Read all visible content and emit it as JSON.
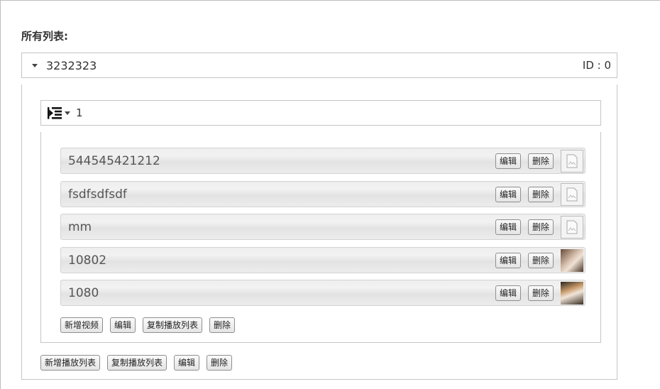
{
  "page": {
    "title": "所有列表:"
  },
  "playlist": {
    "name": "3232323",
    "id_label": "ID : 0",
    "sublist": {
      "name": "1",
      "videos": [
        {
          "title": "544545421212",
          "edit": "编辑",
          "delete": "删除",
          "thumb": "broken-image-icon"
        },
        {
          "title": "fsdfsdfsdf",
          "edit": "编辑",
          "delete": "删除",
          "thumb": "broken-image-icon"
        },
        {
          "title": "mm",
          "edit": "编辑",
          "delete": "删除",
          "thumb": "broken-image-icon"
        },
        {
          "title": "10802",
          "edit": "编辑",
          "delete": "删除",
          "thumb": "photo-thumbnail"
        },
        {
          "title": "1080",
          "edit": "编辑",
          "delete": "删除",
          "thumb": "photo-thumbnail"
        }
      ],
      "actions": {
        "add_video": "新增视频",
        "edit": "编辑",
        "copy": "复制播放列表",
        "delete": "删除"
      }
    },
    "actions": {
      "add_playlist": "新增播放列表",
      "copy": "复制播放列表",
      "edit": "编辑",
      "delete": "删除"
    }
  }
}
